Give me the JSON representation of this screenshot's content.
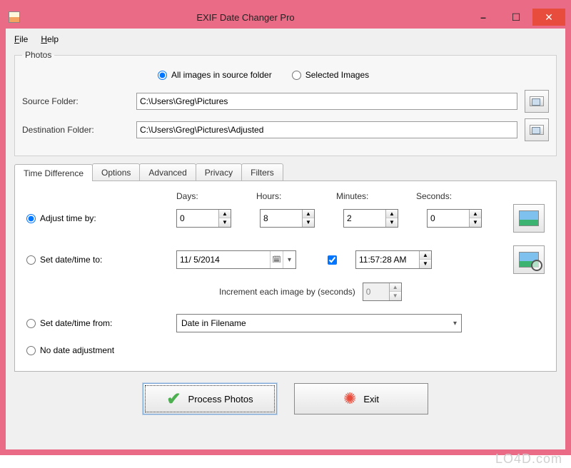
{
  "window": {
    "title": "EXIF Date Changer Pro"
  },
  "menubar": {
    "file": "File",
    "help": "Help"
  },
  "photos": {
    "legend": "Photos",
    "radio_all": "All images in source folder",
    "radio_selected": "Selected Images",
    "source_label": "Source Folder:",
    "source_value": "C:\\Users\\Greg\\Pictures",
    "dest_label": "Destination Folder:",
    "dest_value": "C:\\Users\\Greg\\Pictures\\Adjusted"
  },
  "tabs": {
    "time_diff": "Time Difference",
    "options": "Options",
    "advanced": "Advanced",
    "privacy": "Privacy",
    "filters": "Filters"
  },
  "time_diff": {
    "headers": {
      "days": "Days:",
      "hours": "Hours:",
      "minutes": "Minutes:",
      "seconds": "Seconds:"
    },
    "adjust_label": "Adjust time by:",
    "adjust_values": {
      "days": "0",
      "hours": "8",
      "minutes": "2",
      "seconds": "0"
    },
    "set_to_label": "Set date/time to:",
    "date_value": "11/ 5/2014",
    "time_checkbox_checked": true,
    "time_value": "11:57:28 AM",
    "increment_label": "Increment each image by (seconds)",
    "increment_value": "0",
    "set_from_label": "Set date/time from:",
    "set_from_value": "Date in Filename",
    "no_adjust_label": "No date adjustment"
  },
  "footer": {
    "process": "Process Photos",
    "exit": "Exit"
  },
  "watermark": "LO4D.com"
}
